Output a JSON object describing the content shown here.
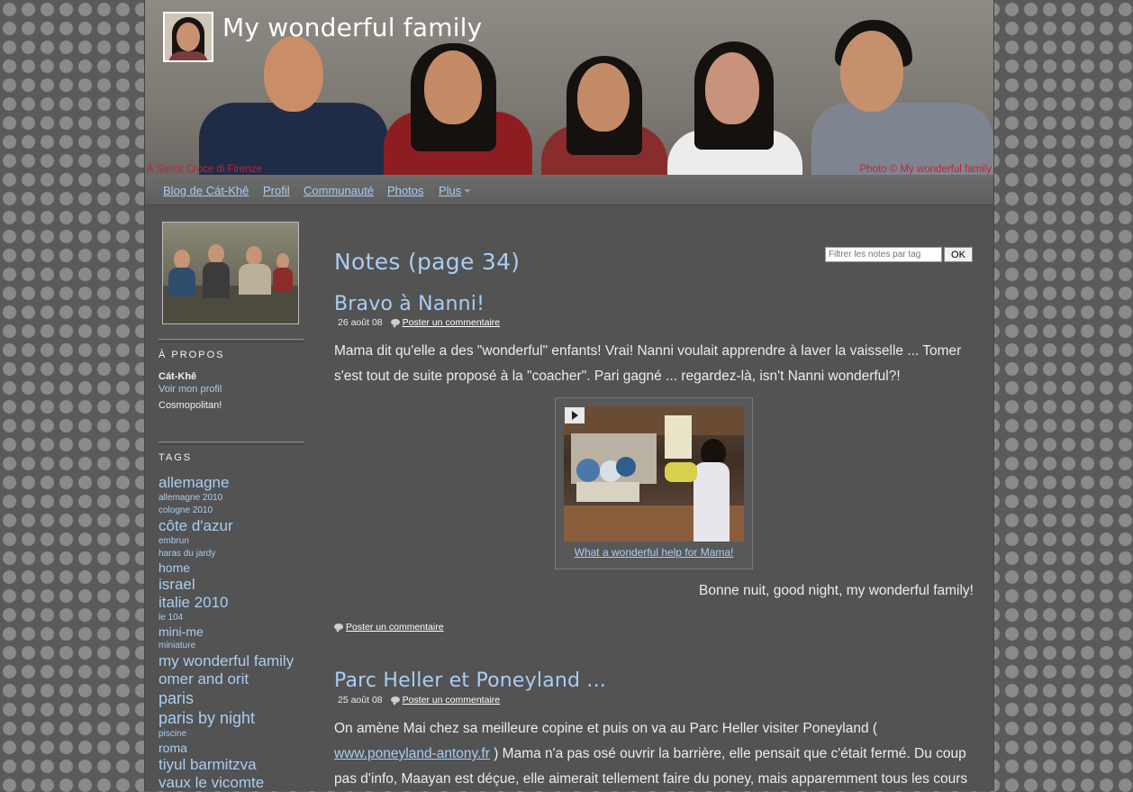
{
  "header": {
    "site_title": "My wonderful family",
    "caption_left": "A Santa Croce di Firenze",
    "caption_right": "Photo © My wonderful family"
  },
  "nav": {
    "items": [
      "Blog de Cát-Khê",
      "Profil",
      "Communauté",
      "Photos",
      "Plus"
    ]
  },
  "sidebar": {
    "about_heading": "À PROPOS",
    "author_name": "Cát-Khê",
    "profile_link": "Voir mon profil",
    "bio": "Cosmopolitan!",
    "tags_heading": "TAGS",
    "tags": [
      {
        "label": "allemagne",
        "size": "s3"
      },
      {
        "label": "allemagne 2010",
        "size": "s1"
      },
      {
        "label": "cologne 2010",
        "size": "s1"
      },
      {
        "label": "côte d'azur",
        "size": "s3"
      },
      {
        "label": "embrun",
        "size": "s1"
      },
      {
        "label": "haras du jardy",
        "size": "s1"
      },
      {
        "label": "home",
        "size": "s2"
      },
      {
        "label": "israel",
        "size": "s3"
      },
      {
        "label": "italie 2010",
        "size": "s3"
      },
      {
        "label": "le 104",
        "size": "s1"
      },
      {
        "label": "mini-me",
        "size": "s2"
      },
      {
        "label": "miniature",
        "size": "s1"
      },
      {
        "label": "my wonderful family",
        "size": "s3"
      },
      {
        "label": "omer and orit",
        "size": "s3"
      },
      {
        "label": "paris",
        "size": "s4"
      },
      {
        "label": "paris by night",
        "size": "s4"
      },
      {
        "label": "piscine",
        "size": "s1"
      },
      {
        "label": "roma",
        "size": "s2"
      },
      {
        "label": "tiyul barmitzva",
        "size": "s3"
      },
      {
        "label": "vaux le vicomte",
        "size": "s3"
      }
    ]
  },
  "main": {
    "page_heading": "Notes (page 34)",
    "filter_placeholder": "Filtrer les notes par tag",
    "ok_label": "OK",
    "posts": [
      {
        "title": "Bravo à Nanni!",
        "date": "26 août 08",
        "comment_label": "Poster un commentaire",
        "body": "Mama dit qu'elle a des \"wonderful\" enfants! Vrai! Nanni voulait apprendre à laver la vaisselle ... Tomer s'est tout de suite proposé à la \"coacher\". Pari gagné ... regardez-là, isn't Nanni wonderful?!",
        "video_caption": "What a wonderful help for Mama!",
        "closing": "Bonne nuit, good night, my wonderful family!",
        "bottom_comment_label": "Poster un commentaire"
      },
      {
        "title": "Parc Heller et Poneyland ...",
        "date": "25 août 08",
        "comment_label": "Poster un commentaire",
        "body_before_link": "On amène Mai chez sa meilleure copine et puis on va au Parc Heller visiter Poneyland ( ",
        "link": "www.poneyland-antony.fr",
        "body_after_link": " ) Mama n'a pas osé ouvrir la barrière, elle pensait que c'était fermé. Du coup pas d'info, Maayan est déçue, elle aimerait tellement faire du poney, mais apparemment tous les cours"
      }
    ]
  },
  "colors": {
    "link": "#a9cdf2",
    "caption": "#c0243a",
    "panel": "#535353"
  }
}
